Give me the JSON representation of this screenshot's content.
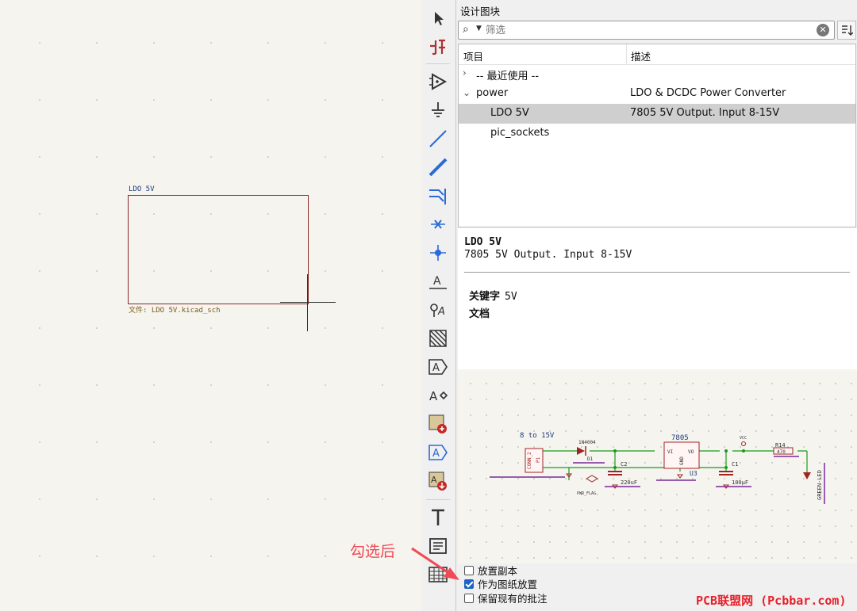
{
  "canvas": {
    "sheet_name": "LDO 5V",
    "sheet_file": "文件: LDO 5V.kicad_sch"
  },
  "toolbar": {
    "tools": [
      {
        "name": "select-tool",
        "glyph": "▲"
      },
      {
        "name": "hierarchy-navigate-tool",
        "glyph": "⇅"
      },
      {
        "name": "add-symbol-tool",
        "glyph": "▷"
      },
      {
        "name": "add-power-tool",
        "glyph": "⏚"
      },
      {
        "name": "draw-wire-tool",
        "glyph": "╱"
      },
      {
        "name": "draw-bus-tool",
        "glyph": "╱"
      },
      {
        "name": "bus-entry-tool",
        "glyph": "⇉"
      },
      {
        "name": "no-connect-tool",
        "glyph": "✕"
      },
      {
        "name": "junction-tool",
        "glyph": "✦"
      },
      {
        "name": "net-label-tool",
        "glyph": "A"
      },
      {
        "name": "global-label-tool",
        "glyph": "A"
      },
      {
        "name": "rule-area-tool",
        "glyph": "▨"
      },
      {
        "name": "hierarchical-label-tool",
        "glyph": "A"
      },
      {
        "name": "sheet-pin-tool",
        "glyph": "A"
      },
      {
        "name": "add-sheet-tool",
        "glyph": "⊕"
      },
      {
        "name": "import-sheet-pin-tool",
        "glyph": "A"
      },
      {
        "name": "design-block-tool",
        "glyph": "A"
      },
      {
        "name": "text-tool",
        "glyph": "T"
      },
      {
        "name": "textbox-tool",
        "glyph": "≡"
      },
      {
        "name": "table-tool",
        "glyph": "▦"
      }
    ]
  },
  "panel": {
    "title": "设计图块",
    "search_placeholder": "筛选",
    "columns": {
      "item": "项目",
      "description": "描述"
    },
    "rows": [
      {
        "arrow": "›",
        "item": "-- 最近使用 --",
        "description": ""
      },
      {
        "arrow": "⌄",
        "item": "power",
        "description": "LDO & DCDC Power Converter"
      },
      {
        "arrow": "",
        "item": "LDO 5V",
        "description": "7805 5V Output. Input 8-15V",
        "selected": true
      },
      {
        "arrow": "",
        "item": "pic_sockets",
        "description": ""
      }
    ],
    "info": {
      "name": "LDO 5V",
      "description": "7805 5V Output. Input 8-15V",
      "keywords_label": "关键字",
      "keywords_value": "5V",
      "documentation_label": "文档"
    },
    "preview": {
      "input_label": "8 to 15V",
      "diode": "1N4004",
      "diode_ref": "D1",
      "regulator": "7805",
      "regulator_ref": "U3",
      "reg_vi": "VI",
      "reg_vo": "VO",
      "reg_gnd": "GND",
      "cap_in_ref": "C2",
      "cap_in_value": "220uF",
      "cap_out_ref": "C1",
      "cap_out_value": "100µF",
      "res_ref": "R14",
      "res_value": "470",
      "led_label": "GREEN-LED",
      "vcc": "VCC",
      "pwr_flag": "PWR_FLAG",
      "conn": "CONN_2",
      "conn_ref": "P1"
    },
    "options": [
      {
        "label": "放置副本",
        "checked": false
      },
      {
        "label": "作为图纸放置",
        "checked": true
      },
      {
        "label": "保留现有的批注",
        "checked": false
      }
    ]
  },
  "annotation": "勾选后",
  "watermark": "PCB联盟网 (Pcbbar.com)",
  "colors": {
    "sheet_border": "#8b2a2a",
    "wire": "#1a9a1a",
    "component": "#a32222",
    "selection": "#cfcfcf",
    "annotation": "#ef4a55",
    "checkbox": "#1f63c6"
  }
}
